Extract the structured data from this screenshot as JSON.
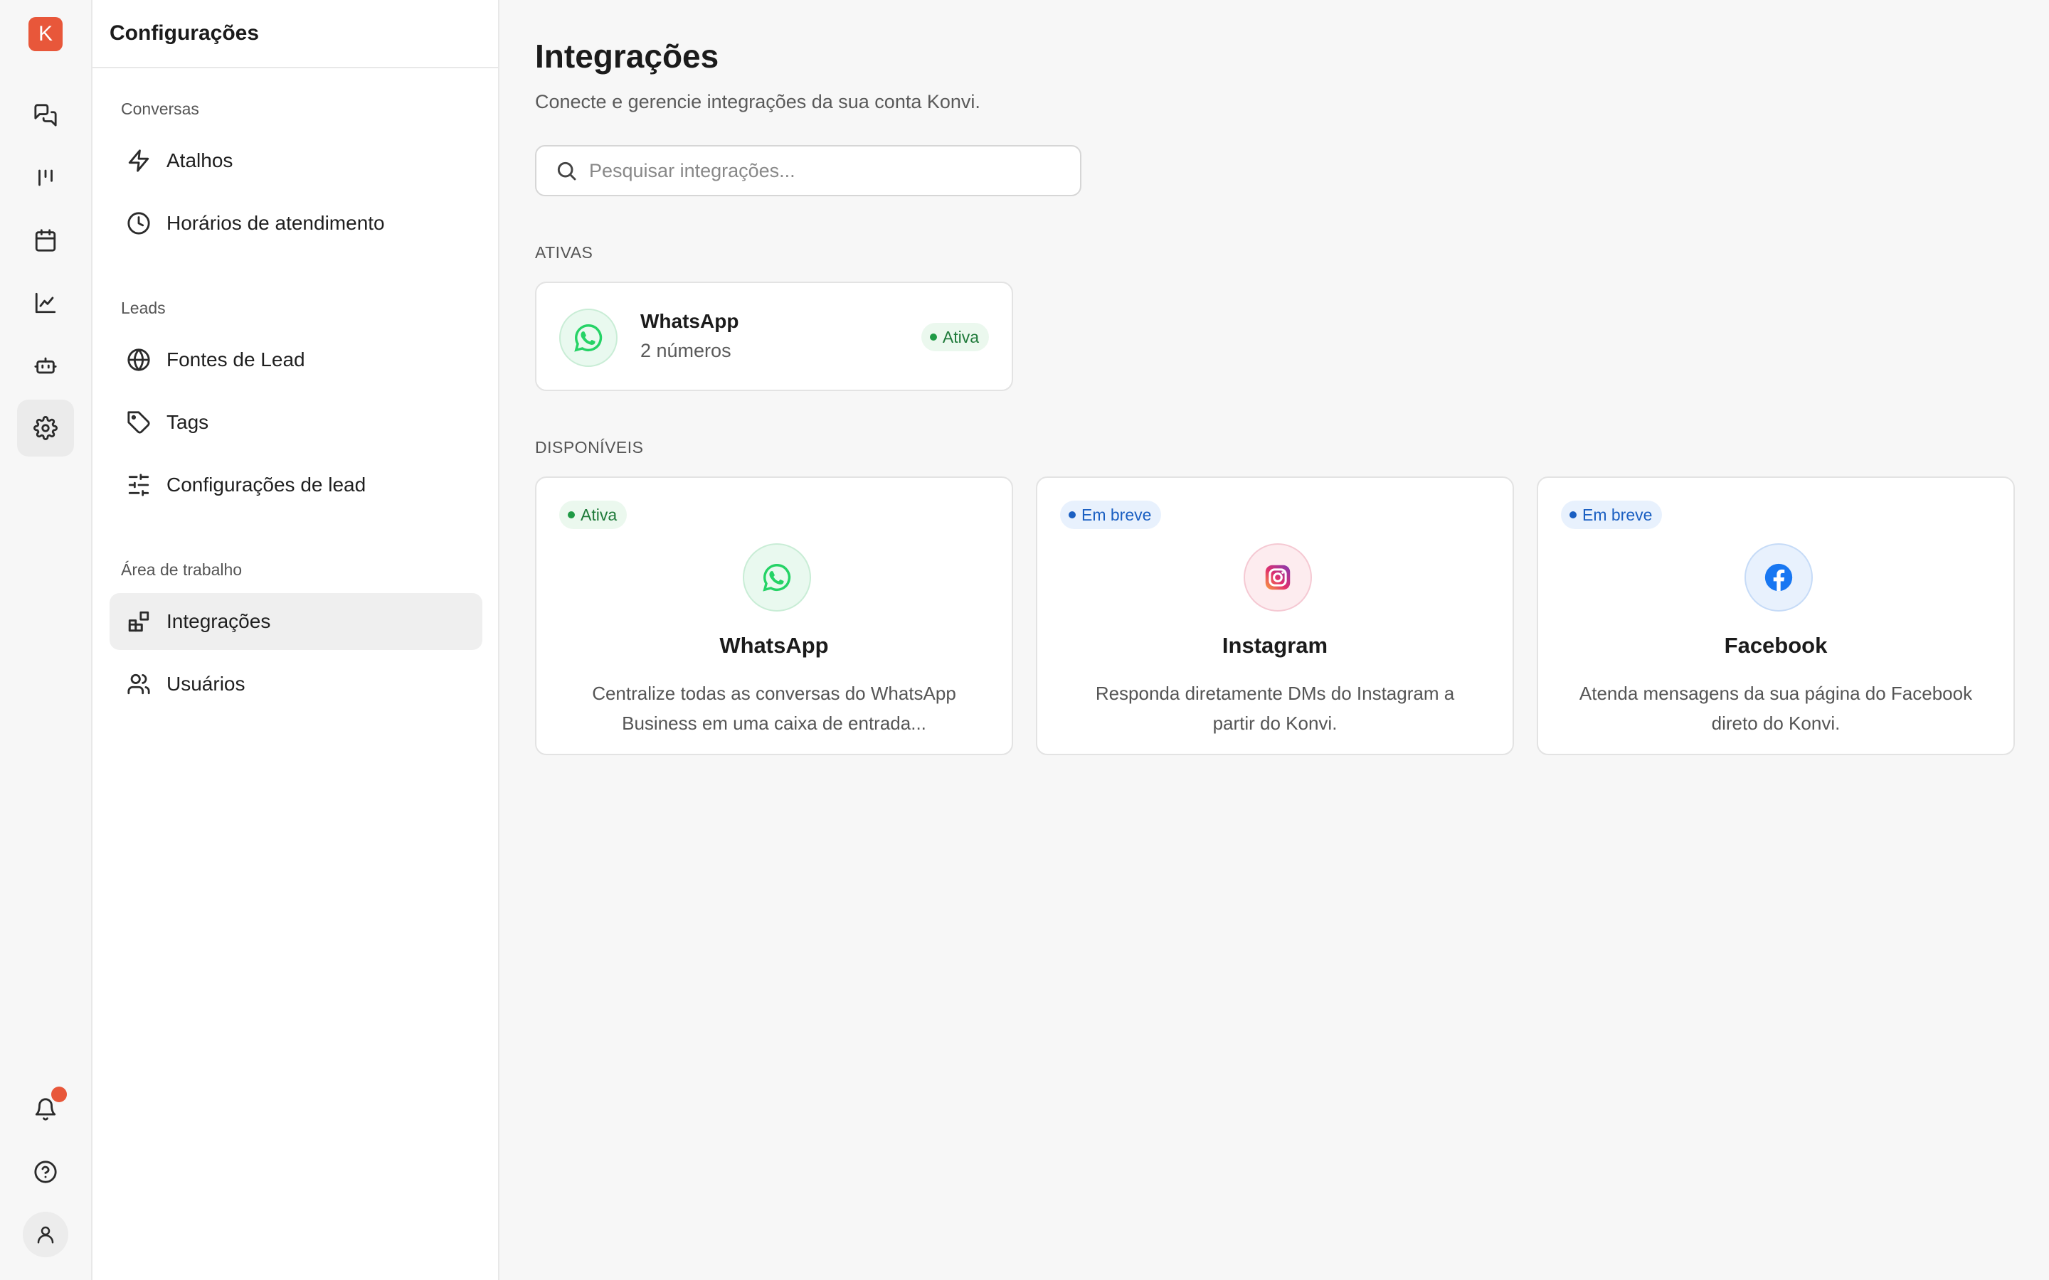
{
  "rail": {
    "logo_letter": "K",
    "items": [
      {
        "icon": "chat-bubbles-icon"
      },
      {
        "icon": "kanban-icon"
      },
      {
        "icon": "calendar-icon"
      },
      {
        "icon": "chart-line-icon"
      },
      {
        "icon": "robot-icon"
      },
      {
        "icon": "gear-icon",
        "active": true
      }
    ],
    "bottom": [
      {
        "icon": "bell-icon",
        "has_notification": true
      },
      {
        "icon": "help-icon"
      },
      {
        "icon": "user-icon"
      }
    ]
  },
  "sidebar": {
    "title": "Configurações",
    "sections": [
      {
        "label": "Conversas",
        "items": [
          {
            "label": "Atalhos",
            "icon": "bolt-icon"
          },
          {
            "label": "Horários de atendimento",
            "icon": "clock-icon"
          }
        ]
      },
      {
        "label": "Leads",
        "items": [
          {
            "label": "Fontes de Lead",
            "icon": "globe-icon"
          },
          {
            "label": "Tags",
            "icon": "tag-icon"
          },
          {
            "label": "Configurações de lead",
            "icon": "sliders-icon"
          }
        ]
      },
      {
        "label": "Área de trabalho",
        "items": [
          {
            "label": "Integrações",
            "icon": "integrations-icon",
            "active": true
          },
          {
            "label": "Usuários",
            "icon": "users-icon"
          }
        ]
      }
    ]
  },
  "main": {
    "title": "Integrações",
    "subtitle": "Conecte e gerencie integrações da sua conta Konvi.",
    "search": {
      "placeholder": "Pesquisar integrações...",
      "value": ""
    },
    "active_section": {
      "label": "ATIVAS",
      "items": [
        {
          "name": "WhatsApp",
          "detail": "2 números",
          "status": "Ativa",
          "icon": "whatsapp-icon"
        }
      ]
    },
    "available_section": {
      "label": "DISPONÍVEIS",
      "cards": [
        {
          "name": "WhatsApp",
          "status": "Ativa",
          "description": "Centralize todas as conversas do WhatsApp Business em uma caixa de entrada...",
          "icon": "whatsapp-icon"
        },
        {
          "name": "Instagram",
          "status": "Em breve",
          "description": "Responda diretamente DMs do Instagram a partir do Konvi.",
          "icon": "instagram-icon"
        },
        {
          "name": "Facebook",
          "status": "Em breve",
          "description": "Atenda mensagens da sua página do Facebook direto do Konvi.",
          "icon": "facebook-icon"
        }
      ]
    }
  },
  "colors": {
    "brand": "#e8573a",
    "active_green": "#1f9a45",
    "soon_blue": "#1a5fc2",
    "whatsapp": "#25d366",
    "facebook": "#1877f2"
  }
}
